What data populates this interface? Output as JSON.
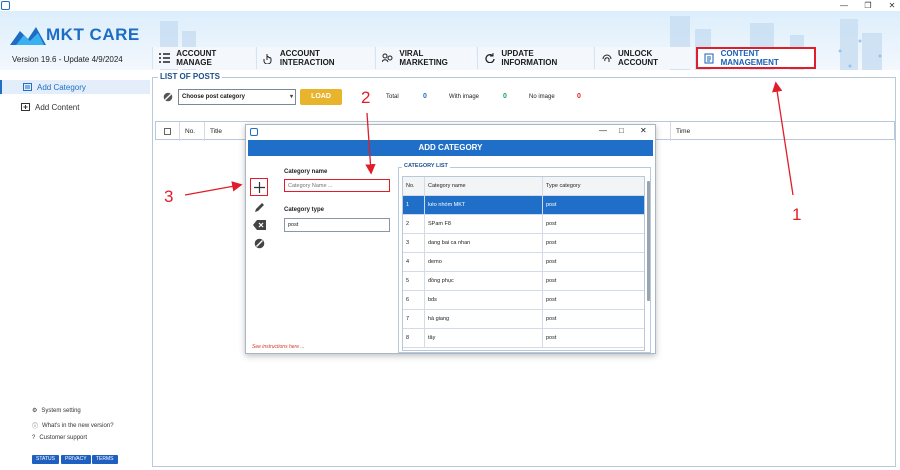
{
  "header": {
    "logo_text": "MKT CARE",
    "version_text": "Version 19.6 - Update 4/9/2024",
    "tabs": [
      {
        "label": "ACCOUNT MANAGE",
        "icon": "list-icon"
      },
      {
        "label": "ACCOUNT INTERACTION",
        "icon": "pointer-hand-icon"
      },
      {
        "label": "VIRAL MARKETING",
        "icon": "users-icon"
      },
      {
        "label": "UPDATE INFORMATION",
        "icon": "refresh-icon"
      },
      {
        "label": "UNLOCK ACCOUNT",
        "icon": "fingerprint-icon"
      },
      {
        "label": "CONTENT MANAGEMENT",
        "icon": "document-icon",
        "active": true
      }
    ]
  },
  "sidebar": {
    "items": [
      {
        "label": "Add Category",
        "active": true
      },
      {
        "label": "Add Content"
      }
    ],
    "footer": [
      "System setting",
      "What's in the new version?",
      "Customer support"
    ],
    "badges": [
      "STATUS",
      "PRIVACY",
      "TERMS"
    ]
  },
  "main": {
    "legend": "LIST OF POSTS",
    "select_value": "Choose post category",
    "load_label": "LOAD",
    "stats": [
      {
        "label": "Total",
        "value": "0",
        "color": "#1f6fc9"
      },
      {
        "label": "With image",
        "value": "0",
        "color": "#19a35a"
      },
      {
        "label": "No image",
        "value": "0",
        "color": "#e01e2a"
      }
    ],
    "columns": [
      "No.",
      "Title",
      "Time"
    ]
  },
  "dialog": {
    "title": "ADD CATEGORY",
    "category_name_label": "Category name",
    "category_name_placeholder": "Category Name ...",
    "category_type_label": "Category type",
    "category_type_value": "post",
    "instructions": "See instructions here ...",
    "list_legend": "CATEGORY LIST",
    "list_columns": [
      "No.",
      "Category name",
      "Type category"
    ],
    "rows": [
      {
        "no": "1",
        "name": "kéo nhóm MKT",
        "type": "post",
        "selected": true
      },
      {
        "no": "2",
        "name": "SPam F8",
        "type": "post"
      },
      {
        "no": "3",
        "name": "dang bai ca nhan",
        "type": "post"
      },
      {
        "no": "4",
        "name": "demo",
        "type": "post"
      },
      {
        "no": "5",
        "name": "đồng phục",
        "type": "post"
      },
      {
        "no": "6",
        "name": "bds",
        "type": "post"
      },
      {
        "no": "7",
        "name": "hà giang",
        "type": "post"
      },
      {
        "no": "8",
        "name": "tây",
        "type": "post"
      }
    ]
  },
  "annotations": [
    "1",
    "2",
    "3"
  ],
  "colors": {
    "accent": "#1f6fc9",
    "highlight": "#e01e2a",
    "load": "#e7b42c"
  }
}
